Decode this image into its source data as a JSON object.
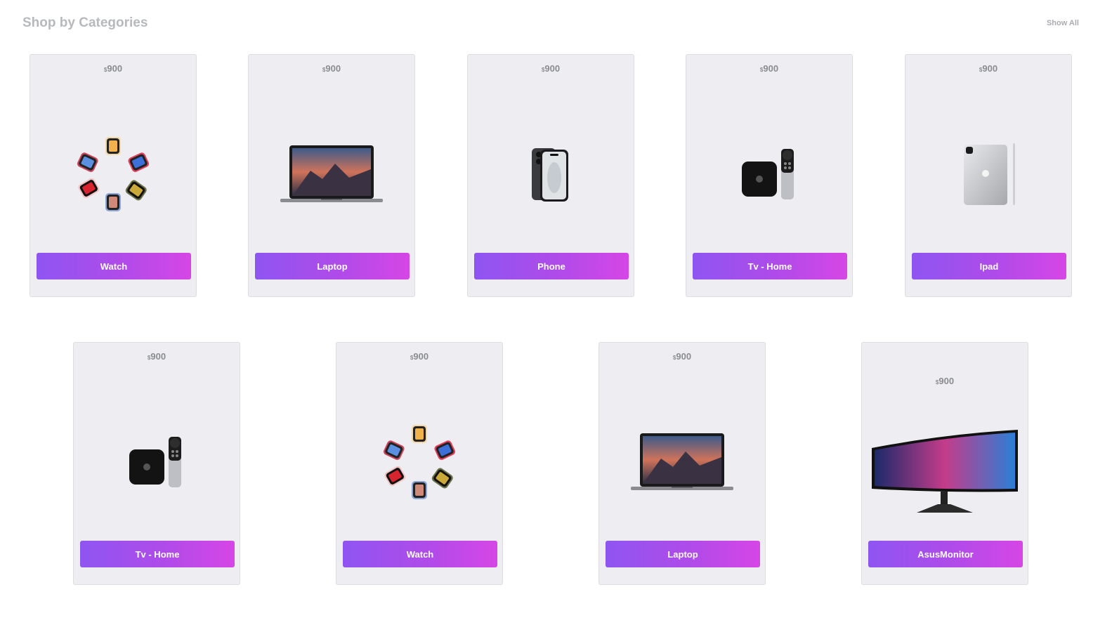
{
  "header": {
    "title": "Shop by Categories",
    "show_all": "Show All"
  },
  "cards": [
    {
      "price": "900",
      "currency": "$",
      "label": "Watch",
      "image": "watch-icon"
    },
    {
      "price": "900",
      "currency": "$",
      "label": "Laptop",
      "image": "laptop-icon"
    },
    {
      "price": "900",
      "currency": "$",
      "label": "Phone",
      "image": "phone-icon"
    },
    {
      "price": "900",
      "currency": "$",
      "label": "Tv - Home",
      "image": "tv-home-icon"
    },
    {
      "price": "900",
      "currency": "$",
      "label": "Ipad",
      "image": "ipad-icon"
    },
    {
      "price": "900",
      "currency": "$",
      "label": "Tv - Home",
      "image": "tv-home-icon"
    },
    {
      "price": "900",
      "currency": "$",
      "label": "Watch",
      "image": "watch-icon"
    },
    {
      "price": "900",
      "currency": "$",
      "label": "Laptop",
      "image": "laptop-icon"
    },
    {
      "price": "900",
      "currency": "$",
      "label": "AsusMonitor",
      "image": "monitor-icon"
    }
  ],
  "colors": {
    "button_start": "#8f55f1",
    "button_end": "#d646e6",
    "card_bg": "#eeeef2"
  }
}
